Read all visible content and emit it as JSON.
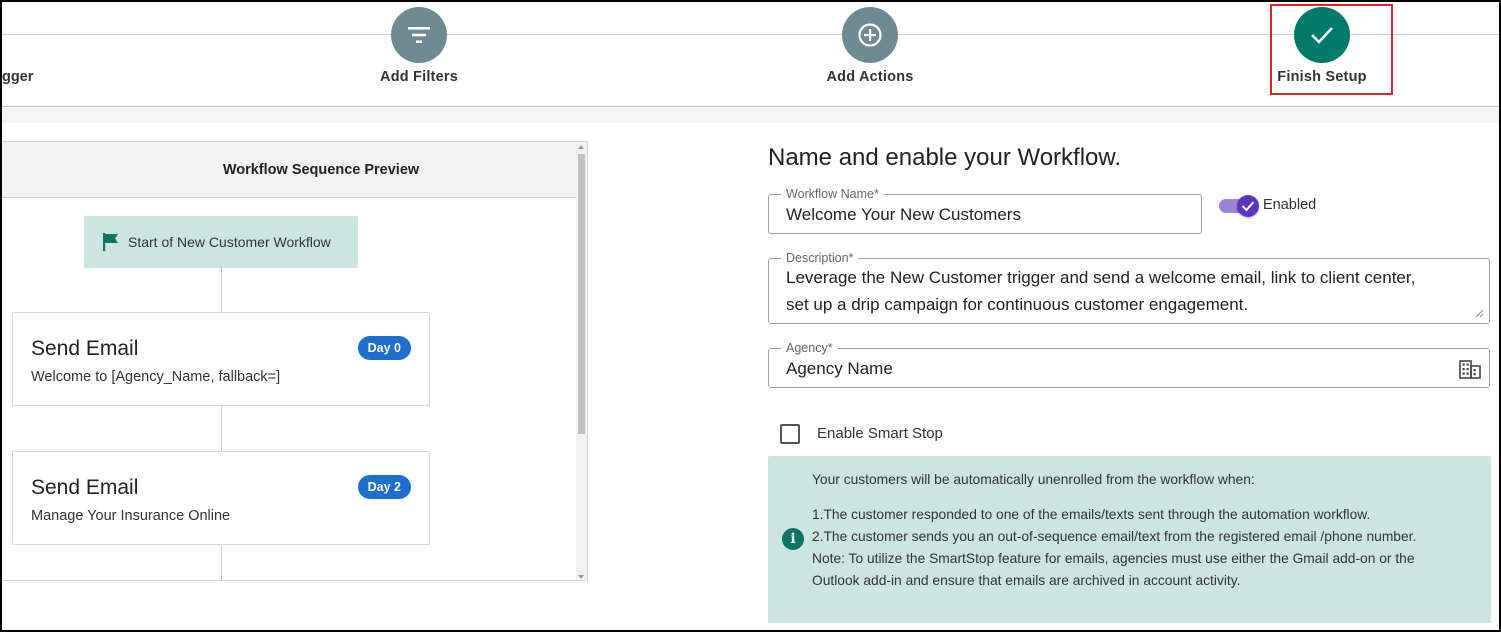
{
  "stepper": {
    "partial_step_label": "gger",
    "steps": [
      {
        "label": "Add Filters",
        "icon": "filter-icon"
      },
      {
        "label": "Add Actions",
        "icon": "plus-circle-icon"
      },
      {
        "label": "Finish Setup",
        "icon": "check-icon"
      }
    ]
  },
  "preview": {
    "header": "Workflow Sequence Preview",
    "start_node": "Start of New Customer Workflow",
    "cards": [
      {
        "title": "Send Email",
        "subtitle": "Welcome to [Agency_Name, fallback=]",
        "badge": "Day 0"
      },
      {
        "title": "Send Email",
        "subtitle": "Manage Your Insurance Online",
        "badge": "Day 2"
      }
    ]
  },
  "form": {
    "title": "Name and enable your Workflow.",
    "workflow_name": {
      "label": "Workflow Name*",
      "value": "Welcome Your New Customers"
    },
    "enabled_label": "Enabled",
    "enabled": true,
    "description": {
      "label": "Description*",
      "line1": "Leverage the New Customer trigger and send a welcome email, link to client center,",
      "line2": "set up a drip campaign for continuous customer engagement."
    },
    "agency": {
      "label": "Agency*",
      "value": "Agency Name",
      "icon": "building-icon"
    },
    "smart_stop_label": "Enable Smart Stop",
    "smart_stop_checked": false,
    "info": {
      "line1": "Your customers will be automatically unenrolled from the workflow when:",
      "line2": "1.The customer responded to one of the emails/texts sent through the automation workflow.",
      "line3": "2.The customer sends you an out-of-sequence email/text from the registered email /phone number.",
      "line4": "Note: To utilize the SmartStop feature for emails, agencies must use either the Gmail add-on or the",
      "line5": "Outlook add-in and ensure that emails are archived in account activity."
    }
  },
  "colors": {
    "step_inactive": "#6f8a92",
    "step_done": "#007a6a",
    "highlight": "#d9262c",
    "badge": "#1f6fd1",
    "toggle": "#5c36c2",
    "info_bg": "#cde5e0"
  }
}
